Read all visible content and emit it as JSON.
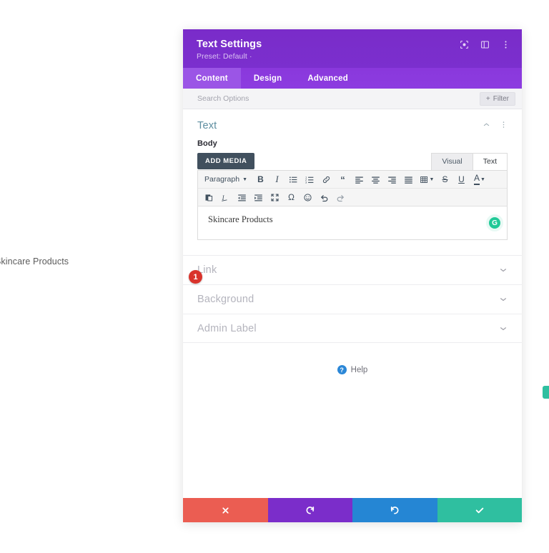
{
  "background_page": {
    "text": "Skincare Products",
    "side_tab_color": "#2fbfa0"
  },
  "modal": {
    "title": "Text Settings",
    "preset": "Preset: Default ·",
    "header_color": "#7b2dca",
    "header_icons": [
      {
        "name": "focus-target-icon",
        "label": "Focus"
      },
      {
        "name": "layout-panel-icon",
        "label": "Layout"
      },
      {
        "name": "more-options-icon",
        "label": "More"
      }
    ],
    "tabs": [
      {
        "label": "Content",
        "active": true
      },
      {
        "label": "Design",
        "active": false
      },
      {
        "label": "Advanced",
        "active": false
      }
    ],
    "search": {
      "placeholder": "Search Options",
      "value": ""
    },
    "filter_button": {
      "label": "Filter",
      "icon": "+"
    },
    "section": {
      "title": "Text",
      "collapse_icon": "chevron-up-icon",
      "menu_icon": "more-options-icon"
    },
    "body_field": {
      "label": "Body",
      "add_media_label": "ADD MEDIA",
      "editor_tabs": [
        {
          "label": "Visual",
          "active": false
        },
        {
          "label": "Text",
          "active": true
        }
      ],
      "format_select": "Paragraph",
      "toolbar_row1": [
        "bold-icon",
        "italic-icon",
        "bulleted-list-icon",
        "numbered-list-icon",
        "link-icon",
        "blockquote-icon",
        "align-left-icon",
        "align-center-icon",
        "align-right-icon",
        "align-justify-icon",
        "table-icon",
        "strikethrough-icon",
        "underline-icon",
        "text-color-icon"
      ],
      "toolbar_row2": [
        "paste-as-text-icon",
        "clear-formatting-icon",
        "outdent-icon",
        "indent-icon",
        "fullscreen-icon",
        "special-character-icon",
        "emoji-icon",
        "undo-icon",
        "redo-icon"
      ],
      "content": "Skincare Products",
      "grammarly_badge": "G"
    },
    "step_badge": "1",
    "accordions": [
      {
        "label": "Link"
      },
      {
        "label": "Background"
      },
      {
        "label": "Admin Label"
      }
    ],
    "help": {
      "icon": "?",
      "label": "Help"
    },
    "footer_buttons": [
      {
        "name": "cancel-button",
        "icon": "close-icon",
        "color": "#eb5d52"
      },
      {
        "name": "undo-button",
        "icon": "undo-icon",
        "color": "#7b2dca"
      },
      {
        "name": "redo-button",
        "icon": "redo-icon",
        "color": "#2586d4"
      },
      {
        "name": "save-button",
        "icon": "check-icon",
        "color": "#2fbfa0"
      }
    ]
  }
}
